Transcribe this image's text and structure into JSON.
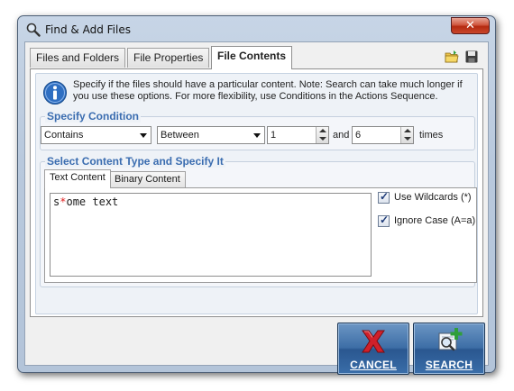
{
  "window": {
    "title": "Find & Add Files",
    "close_glyph": "✕"
  },
  "tabs": [
    {
      "label": "Files and Folders",
      "active": false
    },
    {
      "label": "File Properties",
      "active": false
    },
    {
      "label": "File Contents",
      "active": true
    }
  ],
  "toolbar": {
    "icons": [
      "open-folder-icon",
      "save-icon"
    ]
  },
  "info": {
    "icon": "info-icon",
    "text": "Specify if the files should have a particular content. Note: Search can take much longer if you use these options. For more flexibility, use Conditions in the Actions Sequence."
  },
  "condition": {
    "label": "Specify Condition",
    "match_select": "Contains",
    "range_select": "Between",
    "min_value": "1",
    "and_label": "and",
    "max_value": "6",
    "times_label": "times"
  },
  "content": {
    "label": "Select Content Type and Specify It",
    "subtabs": [
      {
        "label": "Text Content",
        "active": true
      },
      {
        "label": "Binary Content",
        "active": false
      }
    ],
    "text_before": "s",
    "text_highlight": "*",
    "text_after": "ome text",
    "use_wildcards": {
      "label": "Use Wildcards (*)",
      "checked": true
    },
    "ignore_case": {
      "label": "Ignore Case (A=a)",
      "checked": true
    }
  },
  "buttons": {
    "cancel": {
      "label": "CANCEL",
      "icon": "cancel-x-icon"
    },
    "search": {
      "label": "SEARCH",
      "icon": "search-add-icon"
    }
  },
  "colors": {
    "group_label": "#3b6db0",
    "button_blue": "#3d6ea6",
    "cancel_x": "#d0202a",
    "search_plus": "#2f9e3a"
  }
}
